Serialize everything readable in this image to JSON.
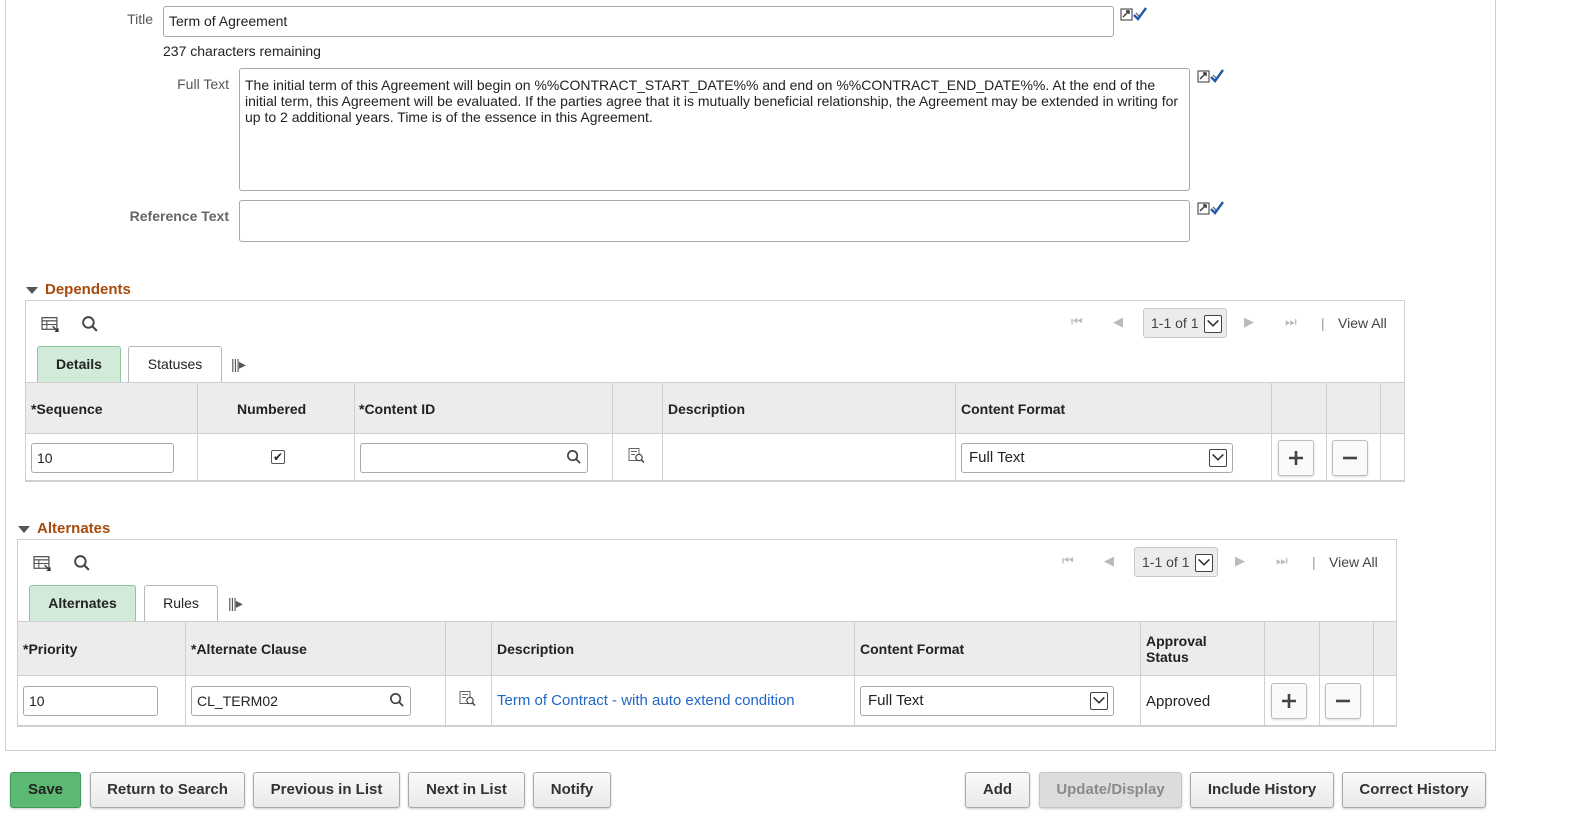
{
  "form": {
    "title_label": "Title",
    "title_value": "Term of Agreement",
    "chars_remaining": "237 characters remaining",
    "full_text_label": "Full Text",
    "full_text_value": "The initial term of this Agreement will begin on %%CONTRACT_START_DATE%% and end on %%CONTRACT_END_DATE%%.  At the end of the initial term, this Agreement will be evaluated.  If the parties agree that it is mutually beneficial relationship, the Agreement may be extended in writing for up to 2 additional years.  Time is of the essence in this Agreement.",
    "reference_text_label": "Reference Text",
    "reference_text_value": ""
  },
  "dependents": {
    "section_title": "Dependents",
    "pager": "1-1 of 1",
    "view_all": "View All",
    "tabs": [
      {
        "label": "Details",
        "active": true
      },
      {
        "label": "Statuses",
        "active": false
      }
    ],
    "columns": [
      "*Sequence",
      "Numbered",
      "*Content ID",
      "Description",
      "Content Format"
    ],
    "rows": [
      {
        "sequence": "10",
        "numbered": true,
        "content_id": "",
        "description": "",
        "content_format": "Full Text"
      }
    ]
  },
  "alternates": {
    "section_title": "Alternates",
    "pager": "1-1 of 1",
    "view_all": "View All",
    "tabs": [
      {
        "label": "Alternates",
        "active": true
      },
      {
        "label": "Rules",
        "active": false
      }
    ],
    "columns": [
      "*Priority",
      "*Alternate Clause",
      "Description",
      "Content Format",
      "Approval Status"
    ],
    "rows": [
      {
        "priority": "10",
        "alternate_clause": "CL_TERM02",
        "description": "Term of Contract - with auto extend condition",
        "content_format": "Full Text",
        "approval_status": "Approved"
      }
    ]
  },
  "buttons": {
    "save": "Save",
    "return_to_search": "Return to Search",
    "previous_in_list": "Previous in List",
    "next_in_list": "Next in List",
    "notify": "Notify",
    "add": "Add",
    "update_display": "Update/Display",
    "include_history": "Include History",
    "correct_history": "Correct History"
  },
  "colors": {
    "section_title": "#a64b0c",
    "active_tab": "#d2ead8",
    "save_button": "#5cb973",
    "link": "#1f66c9"
  }
}
